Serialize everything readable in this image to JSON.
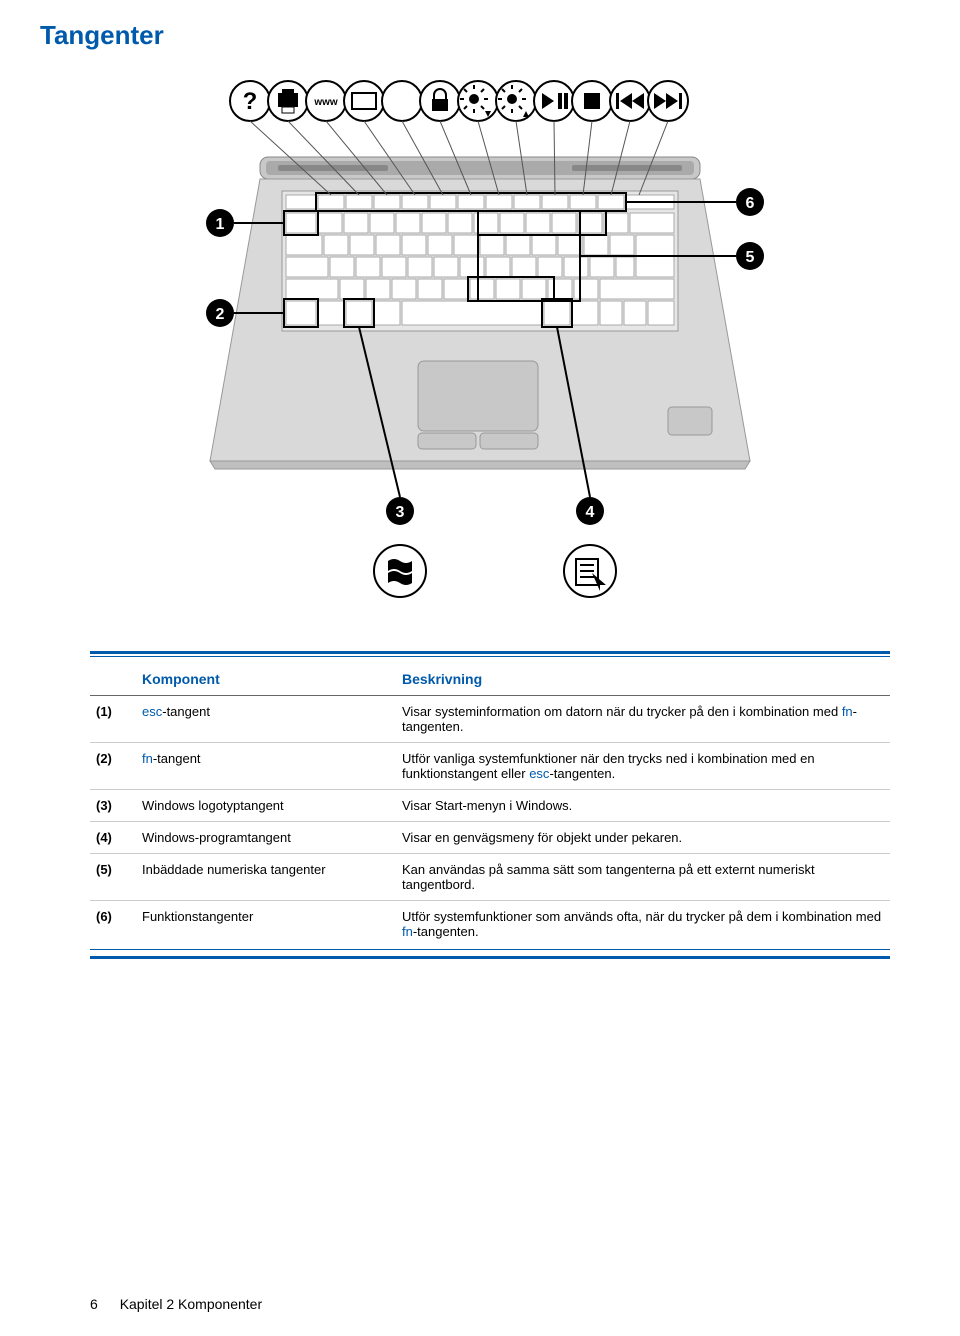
{
  "title": "Tangenter",
  "table": {
    "header_component": "Komponent",
    "header_description": "Beskrivning",
    "rows": [
      {
        "num": "(1)",
        "comp_prefix": "esc",
        "comp_suffix": "-tangent",
        "desc_pre": "Visar systeminformation om datorn när du trycker på den i kombination med ",
        "desc_blue": "fn",
        "desc_post": "-tangenten."
      },
      {
        "num": "(2)",
        "comp_prefix": "fn",
        "comp_suffix": "-tangent",
        "desc_pre": "Utför vanliga systemfunktioner när den trycks ned i kombination med en funktionstangent eller ",
        "desc_blue": "esc",
        "desc_post": "-tangenten."
      },
      {
        "num": "(3)",
        "comp_plain": "Windows logotyptangent",
        "desc_plain": "Visar Start-menyn i Windows."
      },
      {
        "num": "(4)",
        "comp_plain": "Windows-programtangent",
        "desc_plain": "Visar en genvägsmeny för objekt under pekaren."
      },
      {
        "num": "(5)",
        "comp_plain": "Inbäddade numeriska tangenter",
        "desc_plain": "Kan användas på samma sätt som tangenterna på ett externt numeriskt tangentbord."
      },
      {
        "num": "(6)",
        "comp_plain": "Funktionstangenter",
        "desc_pre": "Utför systemfunktioner som används ofta, när du trycker på dem i kombination med ",
        "desc_blue": "fn",
        "desc_post": "-tangenten."
      }
    ]
  },
  "icons": {
    "www_text": "www"
  },
  "callouts": [
    "1",
    "2",
    "3",
    "4",
    "5",
    "6"
  ],
  "footer": {
    "page": "6",
    "chapter": "Kapitel 2   Komponenter"
  }
}
